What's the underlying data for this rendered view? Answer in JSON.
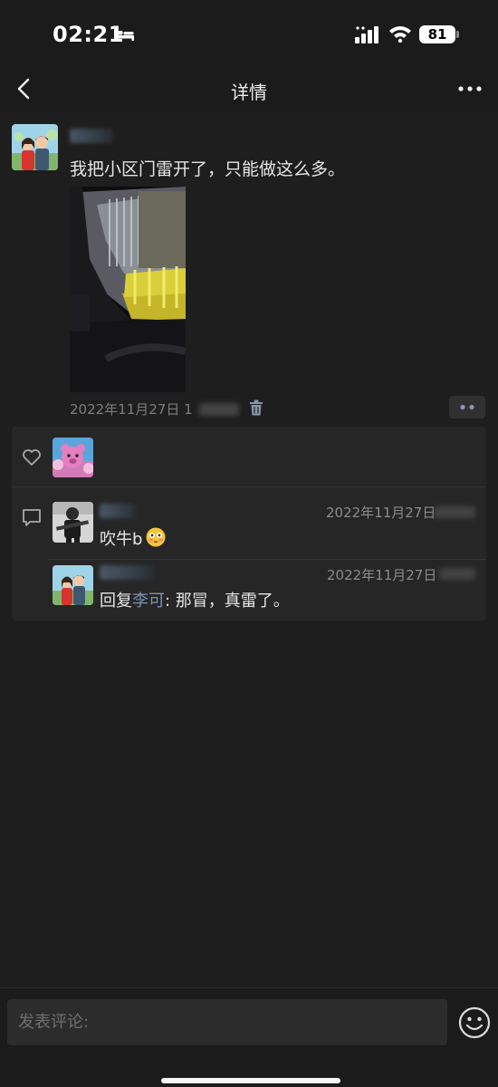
{
  "status_bar": {
    "time": "02:21",
    "battery": "81"
  },
  "nav": {
    "title": "详情"
  },
  "post": {
    "text": "我把小区门雷开了，只能做这么多。",
    "time": "2022年11月27日 1"
  },
  "comments": [
    {
      "time": "2022年11月27日",
      "text": "吹牛b"
    },
    {
      "time": "2022年11月27日",
      "reply_prefix": "回复",
      "reply_to": "李可",
      "text": ": 那冒，真雷了。"
    }
  ],
  "input": {
    "placeholder": "发表评论:"
  },
  "colors": {
    "background": "#1b1b1b",
    "panel": "#262626",
    "link_name": "#7e93b6",
    "meta_text": "#8c8c8c"
  },
  "icons": [
    "bed-icon",
    "signal-icon",
    "wifi-icon",
    "back-icon",
    "more-icon",
    "trash-icon",
    "heart-icon",
    "comment-icon",
    "emoji-icon"
  ]
}
